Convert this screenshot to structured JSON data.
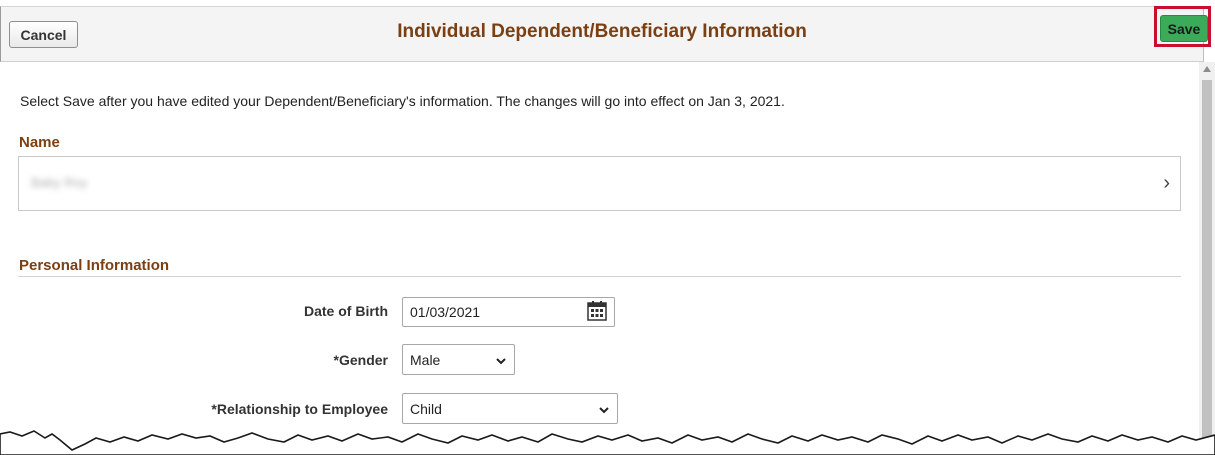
{
  "header": {
    "cancel_label": "Cancel",
    "title": "Individual Dependent/Beneficiary Information",
    "save_label": "Save"
  },
  "instruction": "Select Save after you have edited your Dependent/Beneficiary's information.  The changes will go into effect on Jan 3, 2021.",
  "name_section": {
    "title": "Name",
    "value": "Baby Roy"
  },
  "personal_section": {
    "title": "Personal Information",
    "date_of_birth": {
      "label": "Date of Birth",
      "value": "01/03/2021"
    },
    "gender": {
      "label": "*Gender",
      "value": "Male"
    },
    "relationship": {
      "label": "*Relationship to Employee",
      "value": "Child"
    }
  },
  "colors": {
    "title": "#7a3f12",
    "save_button": "#3bab5a",
    "highlight": "#c8102e"
  }
}
